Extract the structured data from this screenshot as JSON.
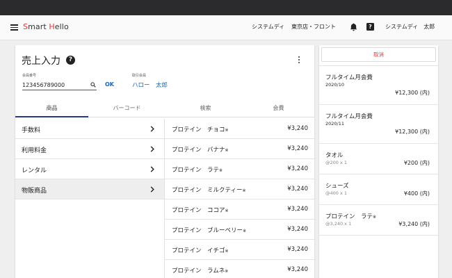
{
  "header": {
    "logo_s": "S",
    "logo_mart": "mart ",
    "logo_h": "H",
    "logo_ello": "ello",
    "store_user": "システムディ",
    "location": "東京店・フロント",
    "help_glyph": "?",
    "user_name": "システムディ　太郎"
  },
  "main": {
    "title": "売上入力",
    "title_help_glyph": "?",
    "member_number_label": "会員番号",
    "member_number_value": "123456789000",
    "ok_label": "OK",
    "partner_label": "取引会員",
    "partner_name": "ハロー　太郎",
    "tabs": [
      {
        "label": "商品",
        "active": true
      },
      {
        "label": "バーコード",
        "active": false
      },
      {
        "label": "検索",
        "active": false
      },
      {
        "label": "会費",
        "active": false
      }
    ],
    "categories": [
      {
        "label": "手数料",
        "selected": false
      },
      {
        "label": "利用料金",
        "selected": false
      },
      {
        "label": "レンタル",
        "selected": false
      },
      {
        "label": "物販商品",
        "selected": true
      }
    ],
    "products": [
      {
        "name": "プロテイン　チョコ",
        "mark": "※",
        "price": "¥3,240"
      },
      {
        "name": "プロテイン　バナナ",
        "mark": "※",
        "price": "¥3,240"
      },
      {
        "name": "プロテイン　ラテ",
        "mark": "※",
        "price": "¥3,240"
      },
      {
        "name": "プロテイン　ミルクティー",
        "mark": "※",
        "price": "¥3,240"
      },
      {
        "name": "プロテイン　ココア",
        "mark": "※",
        "price": "¥3,240"
      },
      {
        "name": "プロテイン　ブルーベリー",
        "mark": "※",
        "price": "¥3,240"
      },
      {
        "name": "プロテイン　イチゴ",
        "mark": "※",
        "price": "¥3,240"
      },
      {
        "name": "プロテイン　ラムネ",
        "mark": "※",
        "price": "¥3,240"
      }
    ]
  },
  "cart": {
    "cancel_label": "取消",
    "items": [
      {
        "type": "membership",
        "name": "フルタイム月会費",
        "mark": "",
        "sub": "2020/10",
        "price": "¥12,300 (内)"
      },
      {
        "type": "membership",
        "name": "フルタイム月会費",
        "mark": "",
        "sub": "2020/11",
        "price": "¥12,300 (内)"
      },
      {
        "type": "goods",
        "name": "タオル",
        "mark": "",
        "sub": "@200 x 1",
        "price": "¥200 (内)"
      },
      {
        "type": "goods",
        "name": "シューズ",
        "mark": "",
        "sub": "@400 x 1",
        "price": "¥400 (内)"
      },
      {
        "type": "goods",
        "name": "プロテイン　ラテ",
        "mark": "※",
        "sub": "@3,240 x 1",
        "price": "¥3,240 (内)"
      }
    ]
  },
  "colors": {
    "accent_blue": "#1565c0",
    "tab_indicator": "#1e3a8a",
    "cancel_red": "#e53935",
    "logo_red": "#e53935"
  }
}
